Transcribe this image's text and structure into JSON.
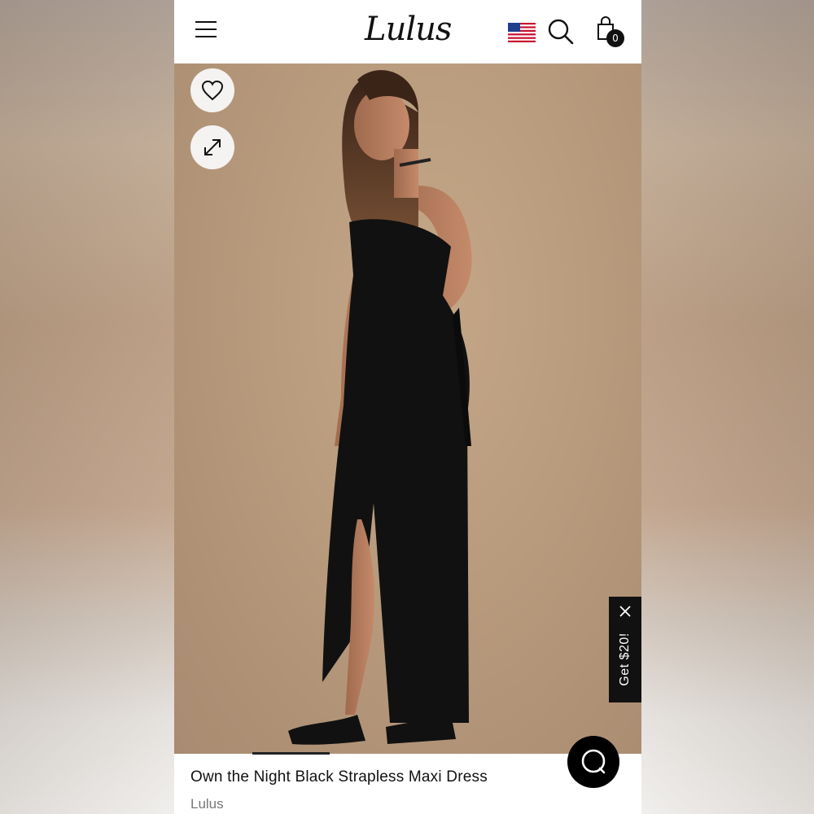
{
  "header": {
    "logo_text": "Lulus",
    "cart_count": "0",
    "icons": [
      "hamburger-menu-icon",
      "us-flag-icon",
      "search-icon",
      "shopping-bag-icon"
    ]
  },
  "gallery": {
    "actions": [
      "heart-icon",
      "expand-icon"
    ],
    "slide_active": 1
  },
  "promo": {
    "label": "Get $20!",
    "close_icon": "close-icon"
  },
  "product": {
    "title": "Own the Night Black Strapless Maxi Dress",
    "brand": "Lulus"
  },
  "chat": {
    "icon": "chat-bubble-icon"
  },
  "colors": {
    "background": "#c4a787",
    "dress": "#111111",
    "accent": "#000000"
  }
}
